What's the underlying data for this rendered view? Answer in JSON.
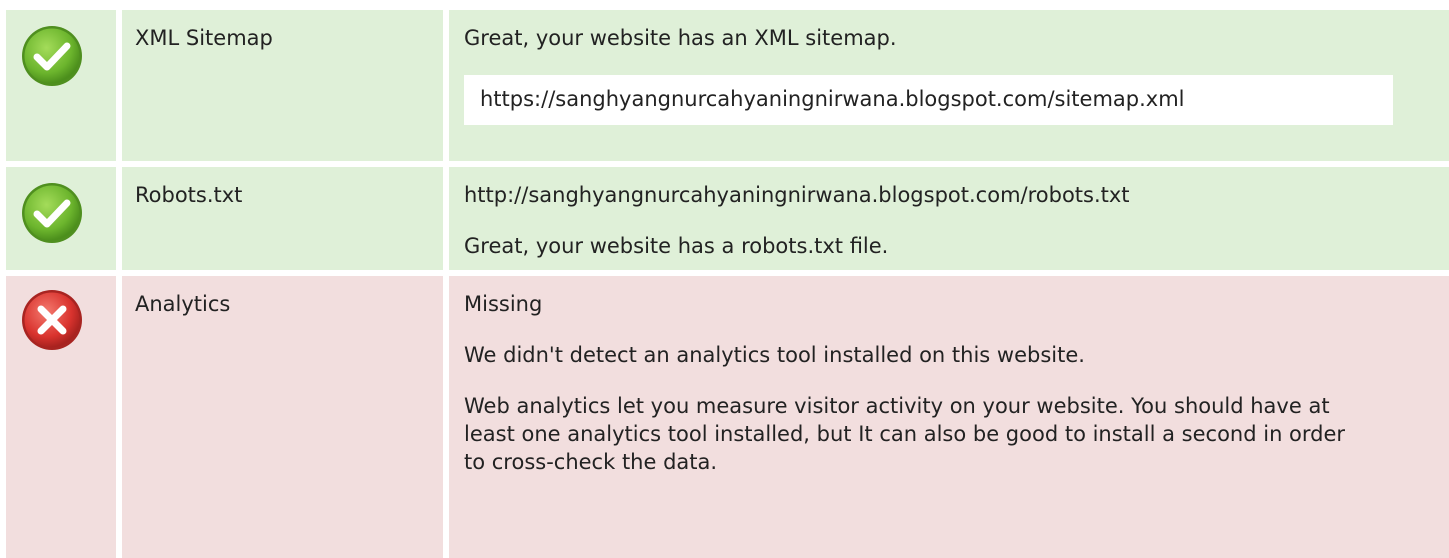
{
  "rows": [
    {
      "status": "pass",
      "icon": "check-icon",
      "name": "XML Sitemap",
      "lines": [
        "Great, your website has an XML sitemap."
      ],
      "url": "https://sanghyangnurcahyaningnirwana.blogspot.com/sitemap.xml"
    },
    {
      "status": "pass",
      "icon": "check-icon",
      "name": "Robots.txt",
      "lines": [
        "http://sanghyangnurcahyaningnirwana.blogspot.com/robots.txt",
        "Great, your website has a robots.txt file."
      ]
    },
    {
      "status": "fail",
      "icon": "cross-icon",
      "name": "Analytics",
      "lines": [
        "Missing",
        "We didn't detect an analytics tool installed on this website.",
        "Web analytics let you measure visitor activity on your website. You should have at least one analytics tool installed, but It can also be good to install a second in order to cross-check the data."
      ]
    }
  ],
  "colors": {
    "pass_bg": "#dff0d8",
    "fail_bg": "#f2dede",
    "pass_icon": "#6cb52d",
    "fail_icon": "#d9332e"
  }
}
